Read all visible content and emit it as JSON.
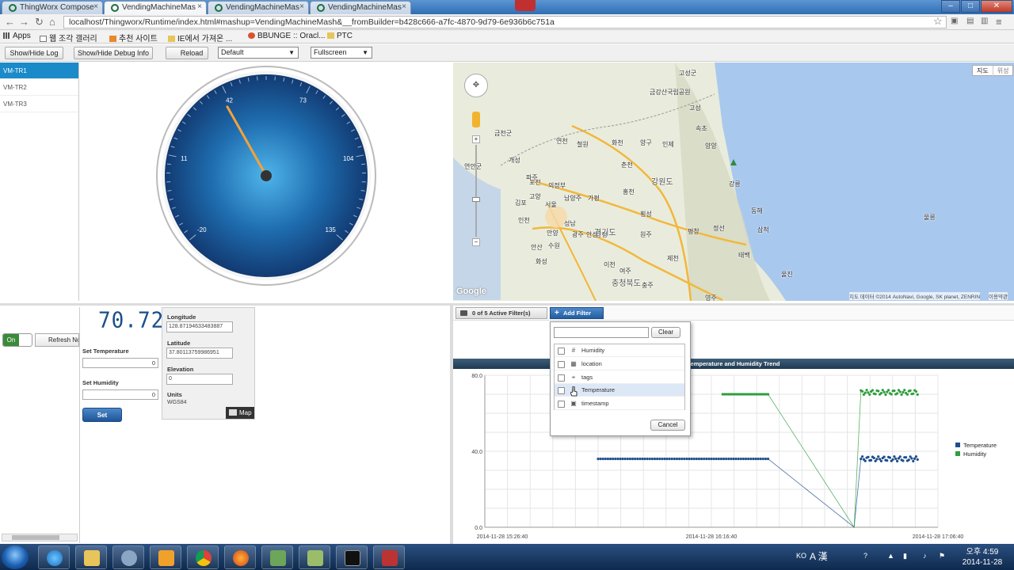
{
  "browser": {
    "tabs": [
      {
        "label": "ThingWorx Compose"
      },
      {
        "label": "VendingMachineMas"
      },
      {
        "label": "VendingMachineMas"
      },
      {
        "label": "VendingMachineMas"
      }
    ],
    "url": "localhost/Thingworx/Runtime/index.html#mashup=VendingMachineMash&__fromBuilder=b428c666-a7fc-4870-9d79-6e936b6c751a",
    "bookmarks": [
      "Apps",
      "웹 조각 갤러리",
      "추천 사이트",
      "IE에서 가져온 ...",
      "BBUNGE :: Oracl...",
      "PTC"
    ]
  },
  "toolbar": {
    "log_label": "Show/Hide Log",
    "debug_label": "Show/Hide Debug Info",
    "reload_label": "Reload",
    "theme_value": "Default",
    "mode_value": "Fullscreen"
  },
  "machines": [
    "VM-TR1",
    "VM-TR2",
    "VM-TR3"
  ],
  "gauge": {
    "ticks": [
      "-20",
      "11",
      "42",
      "73",
      "104",
      "135"
    ],
    "min": -20,
    "max": 135,
    "needle_value": 40
  },
  "map": {
    "type_buttons": [
      "지도",
      "위성"
    ],
    "attribution": "지도 데이터 ©2014 AutoNavi, Google, SK planet, ZENRIN",
    "terms": "이용약관",
    "google": "Google",
    "labels": [
      "고성군",
      "금강산국립공원",
      "고성",
      "속초",
      "양양",
      "강릉",
      "동해",
      "삼척",
      "태백",
      "울진",
      "영주",
      "정선",
      "평창",
      "제천",
      "원주",
      "횡성",
      "홍천",
      "춘천",
      "인제",
      "양구",
      "화천",
      "철원",
      "연천",
      "포천",
      "의정부",
      "파주",
      "고양",
      "서울",
      "남양주",
      "가평",
      "양평",
      "여주",
      "이천",
      "광주",
      "성남",
      "안양",
      "수원",
      "안산",
      "화성",
      "인천",
      "김포",
      "개성",
      "금천군",
      "연안군",
      "충청북도",
      "경기도",
      "강원도",
      "울릉",
      "충주",
      "안성"
    ]
  },
  "controls": {
    "toggle_label": "On",
    "refresh_label": "Refresh Now"
  },
  "device": {
    "display_value": "70.72",
    "set_temperature_label": "Set Temperature",
    "set_temperature_value": "0",
    "set_humidity_label": "Set Humidity",
    "set_humidity_value": "0",
    "set_button": "Set"
  },
  "location": {
    "longitude_label": "Longitude",
    "longitude_value": "128.87194633483887",
    "latitude_label": "Latitude",
    "latitude_value": "37.80113759986951",
    "elevation_label": "Elevation",
    "elevation_value": "0",
    "units_label": "Units",
    "units_value": "WGS84",
    "map_button": "Map"
  },
  "filters": {
    "active_label": "0 of 5 Active Filter(s)",
    "add_label": "Add Filter",
    "clear_label": "Clear",
    "cancel_label": "Cancel",
    "items": [
      {
        "label": "Humidity",
        "icon": "hash-icon",
        "highlighted": false
      },
      {
        "label": "location",
        "icon": "location-icon",
        "highlighted": false
      },
      {
        "label": "tags",
        "icon": "tag-icon",
        "highlighted": false
      },
      {
        "label": "Temperature",
        "icon": "hash-icon",
        "highlighted": true
      },
      {
        "label": "timestamp",
        "icon": "calendar-icon",
        "highlighted": false
      }
    ]
  },
  "chart_data": {
    "type": "line",
    "title": "Temperature and Humidity Trend",
    "ylim": [
      0,
      80
    ],
    "y_ticks": [
      "0.0",
      "40.0",
      "80.0"
    ],
    "x_ticks": [
      "2014-11-28 15:26:40",
      "2014-11-28 16:16:40",
      "2014-11-28 17:06:40"
    ],
    "colors": {
      "Temperature": "#1f4e8c",
      "Humidity": "#2e9e3e"
    },
    "series": [
      {
        "name": "Temperature",
        "segments": [
          {
            "from": 0.25,
            "to": 0.625,
            "y": 36,
            "count": 70,
            "jitter": 0
          },
          {
            "from": 0.83,
            "to": 0.955,
            "y": 36,
            "count": 40,
            "jitter": 1.2
          }
        ],
        "drop": {
          "x": 0.815,
          "y": 0
        }
      },
      {
        "name": "Humidity",
        "segments": [
          {
            "from": 0.525,
            "to": 0.625,
            "y": 70,
            "count": 25,
            "jitter": 0
          },
          {
            "from": 0.83,
            "to": 0.955,
            "y": 71,
            "count": 40,
            "jitter": 1.2
          }
        ],
        "drop": {
          "x": 0.815,
          "y": 0
        }
      }
    ],
    "legend": "right",
    "grid": true
  },
  "taskbar": {
    "lang": "KO",
    "ime": "A 漢",
    "time": "오후 4:59",
    "date": "2014-11-28"
  }
}
